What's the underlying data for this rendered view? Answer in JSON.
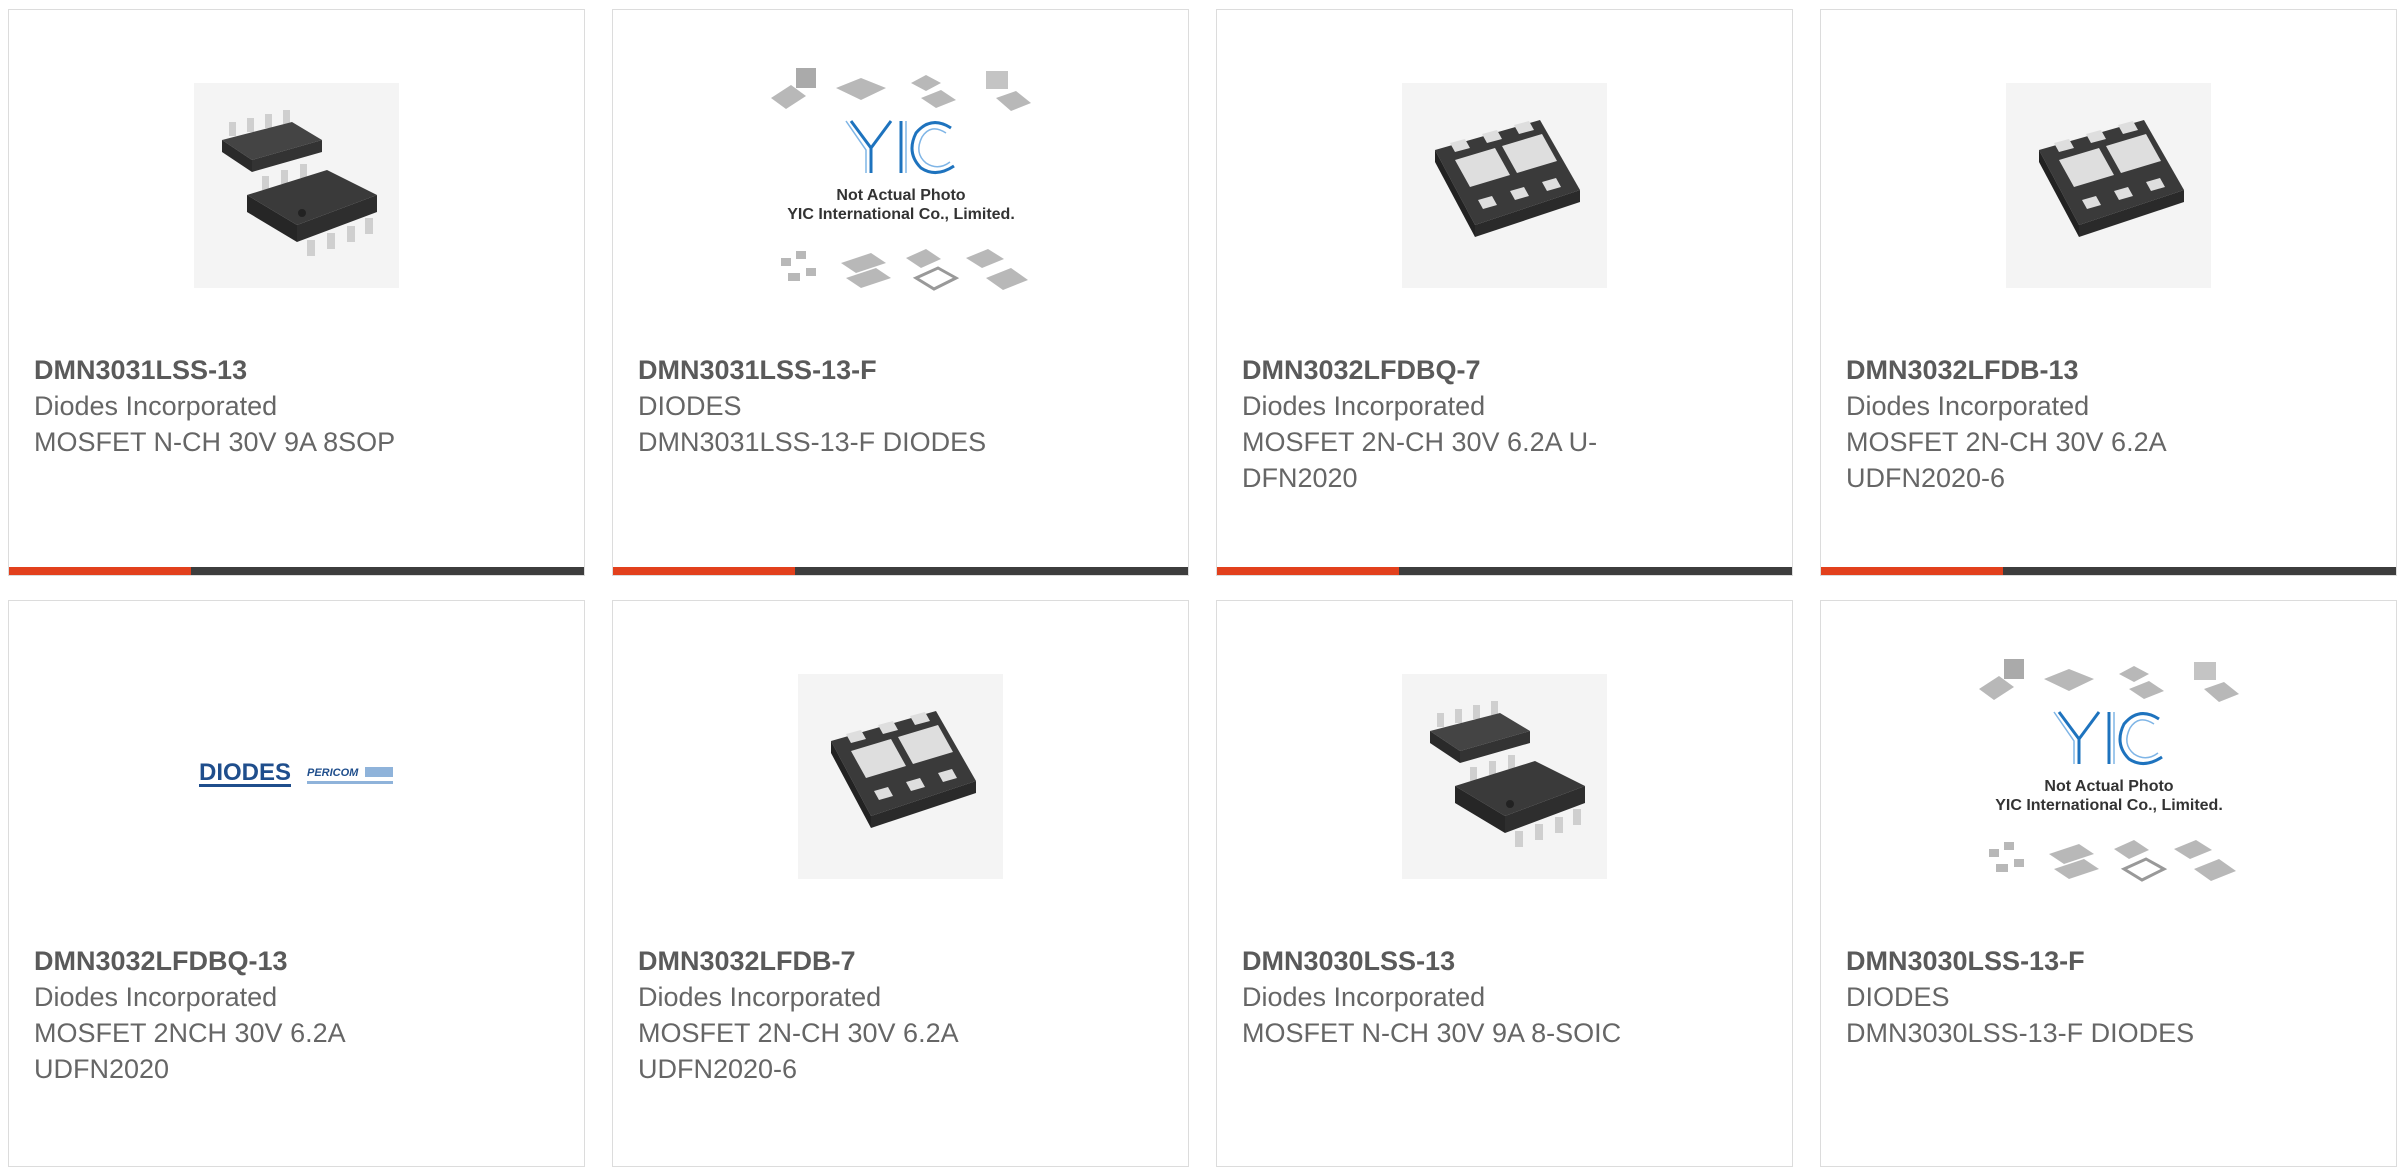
{
  "colors": {
    "accent": "#e2401c",
    "bar": "#3d3d3d",
    "border": "#dcdcdc",
    "text": "#666666"
  },
  "placeholder": {
    "line1": "Not Actual Photo",
    "line2": "YIC International Co., Limited."
  },
  "logos": {
    "diodes": "DIODES",
    "pericom": "PERICOM"
  },
  "products": [
    {
      "part": "DMN3031LSS-13",
      "manufacturer": "Diodes Incorporated",
      "description": "MOSFET N-CH 30V 9A 8SOP",
      "image": "soic-8-package"
    },
    {
      "part": "DMN3031LSS-13-F",
      "manufacturer": "DIODES",
      "description": "DMN3031LSS-13-F DIODES",
      "image": "not-actual-photo-placeholder"
    },
    {
      "part": "DMN3032LFDBQ-7",
      "manufacturer": "Diodes Incorporated",
      "description": "MOSFET 2N-CH 30V 6.2A U-DFN2020",
      "image": "udfn-package"
    },
    {
      "part": "DMN3032LFDB-13",
      "manufacturer": "Diodes Incorporated",
      "description": "MOSFET 2N-CH 30V 6.2A UDFN2020-6",
      "image": "udfn-package"
    },
    {
      "part": "DMN3032LFDBQ-13",
      "manufacturer": "Diodes Incorporated",
      "description": "MOSFET 2NCH 30V 6.2A UDFN2020",
      "image": "diodes-pericom-logo"
    },
    {
      "part": "DMN3032LFDB-7",
      "manufacturer": "Diodes Incorporated",
      "description": "MOSFET 2N-CH 30V 6.2A UDFN2020-6",
      "image": "udfn-package"
    },
    {
      "part": "DMN3030LSS-13",
      "manufacturer": "Diodes Incorporated",
      "description": "MOSFET N-CH 30V 9A 8-SOIC",
      "image": "soic-8-package"
    },
    {
      "part": "DMN3030LSS-13-F",
      "manufacturer": "DIODES",
      "description": "DMN3030LSS-13-F DIODES",
      "image": "not-actual-photo-placeholder"
    }
  ]
}
